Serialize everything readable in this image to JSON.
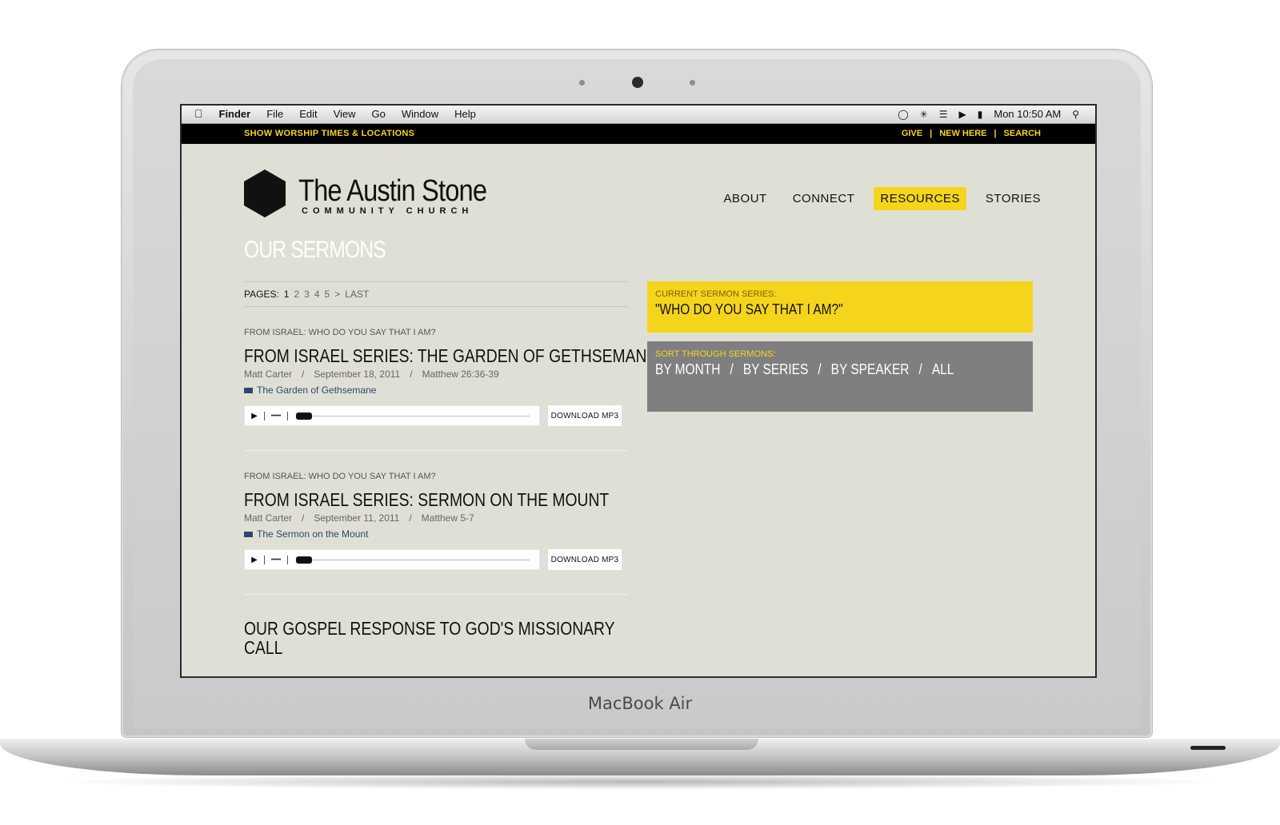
{
  "device": {
    "brand": "MacBook Air"
  },
  "menubar": {
    "app": "Finder",
    "items": [
      "File",
      "Edit",
      "View",
      "Go",
      "Window",
      "Help"
    ],
    "clock": "Mon 10:50 AM",
    "icons": [
      "apple-icon",
      "chat-icon",
      "bluetooth-icon",
      "wifi-icon",
      "volume-icon",
      "battery-icon",
      "spotlight-icon"
    ]
  },
  "topbar": {
    "show_times": "SHOW WORSHIP TIMES & LOCATIONS",
    "links": [
      "GIVE",
      "NEW HERE",
      "SEARCH"
    ],
    "separator": "|"
  },
  "logo": {
    "name": "The Austin Stone",
    "sub": "COMMUNITY CHURCH"
  },
  "nav": {
    "items": [
      "ABOUT",
      "CONNECT",
      "RESOURCES",
      "STORIES"
    ],
    "active": "RESOURCES"
  },
  "page": {
    "title": "OUR SERMONS"
  },
  "pager": {
    "label": "PAGES:",
    "pages": [
      "1",
      "2",
      "3",
      "4",
      "5",
      ">",
      "LAST"
    ],
    "current": "1"
  },
  "sermons": [
    {
      "kicker": "FROM ISRAEL: WHO DO YOU SAY THAT I AM?",
      "title": "FROM ISRAEL SERIES: THE GARDEN OF GETHSEMANE",
      "speaker": "Matt Carter",
      "date": "September 18, 2011",
      "scripture": "Matthew 26:36-39",
      "video": "The Garden of Gethsemane",
      "download": "DOWNLOAD MP3"
    },
    {
      "kicker": "FROM ISRAEL: WHO DO YOU SAY THAT I AM?",
      "title": "FROM ISRAEL SERIES: SERMON ON THE MOUNT",
      "speaker": "Matt Carter",
      "date": "September 11, 2011",
      "scripture": "Matthew 5-7",
      "video": "The Sermon on the Mount",
      "download": "DOWNLOAD MP3"
    }
  ],
  "meta_separator": "/",
  "next_sermon": {
    "title": "OUR GOSPEL RESPONSE TO GOD'S MISSIONARY CALL"
  },
  "current_series": {
    "label": "CURRENT SERMON SERIES:",
    "title": "\"WHO DO YOU SAY THAT I AM?\""
  },
  "sort": {
    "label": "SORT THROUGH SERMONS:",
    "links": [
      "BY MONTH",
      "BY SERIES",
      "BY SPEAKER",
      "ALL"
    ],
    "separator": "/"
  },
  "colors": {
    "accent": "#f5d51b",
    "page_bg": "#e0dfd5",
    "sort_bg": "#7f7f80",
    "topbar_bg": "#000000"
  }
}
